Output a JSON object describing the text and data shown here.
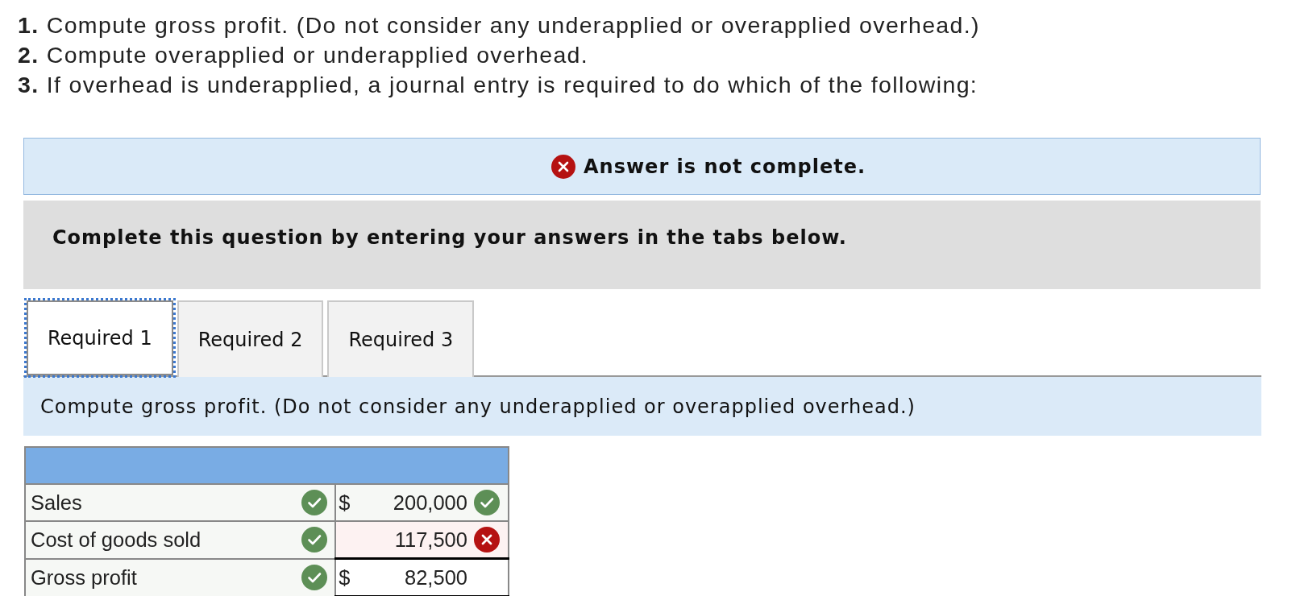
{
  "instructions": [
    "**1.** Compute gross profit. (Do not consider any underapplied or overapplied overhead.)",
    "**2.** Compute overapplied or underapplied overhead.",
    "**3.** If overhead is underapplied, a journal entry is required to do which of the following:"
  ],
  "status_banner": {
    "kind": "incorrect",
    "text": "Answer is not complete."
  },
  "prompt": "Complete this question by entering your answers in the tabs below.",
  "tabs": [
    {
      "label": "Required 1",
      "selected": true
    },
    {
      "label": "Required 2",
      "selected": false
    },
    {
      "label": "Required 3",
      "selected": false
    }
  ],
  "tab_instruction": "Compute gross profit. (Do not consider any underapplied or overapplied overhead.)",
  "table": {
    "rows": [
      {
        "kind": "entry",
        "label": "Sales",
        "label_correct": true,
        "currency": "$",
        "value": "200,000",
        "value_correct": true
      },
      {
        "kind": "entry",
        "label": "Cost of goods sold",
        "label_correct": true,
        "value": "117,500",
        "value_correct": false
      },
      {
        "kind": "total",
        "label": "Gross profit",
        "label_correct": true,
        "currency": "$",
        "value": "82,500"
      }
    ]
  }
}
